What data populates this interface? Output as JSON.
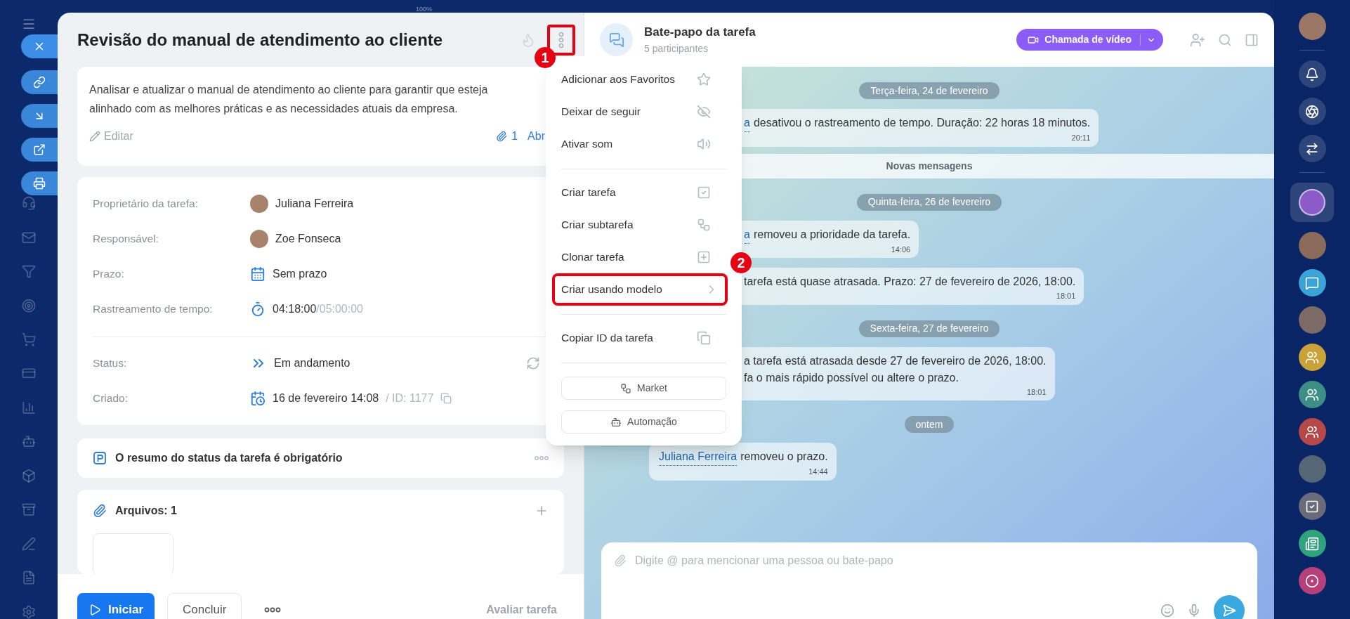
{
  "top_label": "100%",
  "task": {
    "title": "Revisão do manual de atendimento ao cliente",
    "more_button": {
      "callout": "1"
    },
    "description": "Analisar e atualizar o manual de atendimento ao cliente para garantir que esteja alinhado com as melhores práticas e as necessidades atuais da empresa.",
    "edit_label": "Editar",
    "attachments_count": "1",
    "open_label": "Abr",
    "field_groups": [
      [
        {
          "kind": "person",
          "label": "Proprietário da tarefa:",
          "value": "Juliana Ferreira"
        },
        {
          "kind": "person",
          "label": "Responsável:",
          "value": "Zoe Fonseca"
        },
        {
          "kind": "deadline",
          "label": "Prazo:",
          "value": "Sem prazo"
        },
        {
          "kind": "timer",
          "label": "Rastreamento de tempo:",
          "value": "04:18:00",
          "secondary": "/05:00:00"
        }
      ],
      [
        {
          "kind": "status",
          "label": "Status:",
          "value": "Em andamento"
        },
        {
          "kind": "created",
          "label": "Criado:",
          "value": "16 de fevereiro 14:08",
          "secondary": "/ ID: 1177"
        }
      ]
    ],
    "summary": "O resumo do status da tarefa é obrigatório",
    "files_title": "Arquivos: 1",
    "footer": {
      "start": "Iniciar",
      "complete": "Concluir",
      "rate": "Avaliar tarefa"
    }
  },
  "menu": {
    "groups": [
      {
        "items": [
          {
            "label": "Adicionar aos Favoritos",
            "kind": "action"
          },
          {
            "label": "Deixar de seguir",
            "kind": "action"
          },
          {
            "label": "Ativar som",
            "kind": "action"
          }
        ]
      },
      {
        "items": [
          {
            "label": "Criar tarefa",
            "kind": "action"
          },
          {
            "label": "Criar subtarefa",
            "kind": "action"
          },
          {
            "label": "Clonar tarefa",
            "kind": "action"
          },
          {
            "label": "Criar usando modelo",
            "kind": "submenu",
            "callout": "2"
          }
        ]
      },
      {
        "items": [
          {
            "label": "Copiar ID da tarefa",
            "kind": "action"
          }
        ]
      }
    ],
    "buttons": [
      "Market",
      "Automação"
    ]
  },
  "chat": {
    "title": "Bate-papo da tarefa",
    "subtitle": "5 participantes",
    "video_button": "Chamada de vídeo",
    "timeline": [
      {
        "kind": "date",
        "text": "Terça-feira, 24 de fevereiro"
      },
      {
        "kind": "message",
        "clipped": true,
        "link": "a",
        "lines": [
          "desativou o rastreamento de tempo. Duração: 22 horas 18 minutos."
        ],
        "time": "20:11"
      },
      {
        "kind": "divider",
        "text": "Novas mensagens"
      },
      {
        "kind": "date",
        "text": "Quinta-feira, 26 de fevereiro"
      },
      {
        "kind": "message",
        "clipped": true,
        "link": "a",
        "lines": [
          "removeu a prioridade da tarefa."
        ],
        "time": "14:06"
      },
      {
        "kind": "message",
        "clipped": true,
        "lines": [
          "tarefa está quase atrasada. Prazo: 27 de fevereiro de 2026, 18:00."
        ],
        "time": "18:01"
      },
      {
        "kind": "date",
        "text": "Sexta-feira, 27 de fevereiro"
      },
      {
        "kind": "message",
        "clipped": true,
        "lines": [
          "a tarefa está atrasada desde 27 de fevereiro de 2026, 18:00.",
          "fa o mais rápido possível ou altere o prazo."
        ],
        "time": "18:01"
      },
      {
        "kind": "date",
        "text": "ontem"
      },
      {
        "kind": "message",
        "clipped": false,
        "link": "Juliana Ferreira",
        "lines": [
          "removeu o prazo."
        ],
        "time": "14:44"
      }
    ],
    "input_placeholder": "Digite @ para mencionar uma pessoa ou bate-papo"
  }
}
